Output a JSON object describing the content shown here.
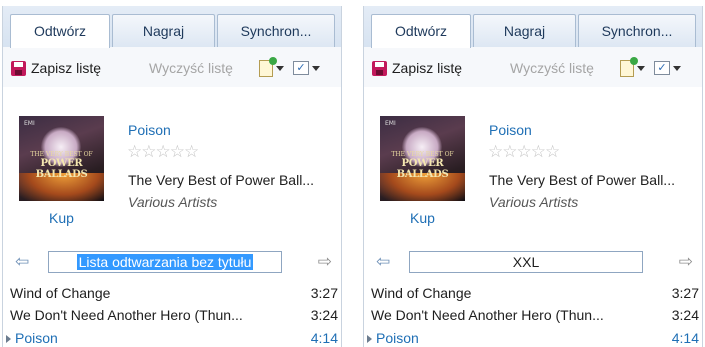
{
  "panels": [
    {
      "tabs": [
        "Odtwórz",
        "Nagraj",
        "Synchron..."
      ],
      "toolbar": {
        "save_label": "Zapisz listę",
        "clear_label": "Wyczyść listę"
      },
      "now_playing": {
        "title": "Poison",
        "album": "The Very Best of Power Ball...",
        "artist": "Various Artists",
        "rating": 0,
        "buy_label": "Kup"
      },
      "playlist_name": "Lista odtwarzania bez tytułu",
      "tracks": [
        {
          "title": "Wind of Change",
          "duration": "3:27"
        },
        {
          "title": "We Don't Need Another Hero (Thun...",
          "duration": "3:24"
        },
        {
          "title": "Poison",
          "duration": "4:14"
        }
      ]
    },
    {
      "tabs": [
        "Odtwórz",
        "Nagraj",
        "Synchron..."
      ],
      "toolbar": {
        "save_label": "Zapisz listę",
        "clear_label": "Wyczyść listę"
      },
      "now_playing": {
        "title": "Poison",
        "album": "The Very Best of Power Ball...",
        "artist": "Various Artists",
        "rating": 0,
        "buy_label": "Kup"
      },
      "playlist_name": "XXL",
      "tracks": [
        {
          "title": "Wind of Change",
          "duration": "3:27"
        },
        {
          "title": "We Don't Need Another Hero (Thun...",
          "duration": "3:24"
        },
        {
          "title": "Poison",
          "duration": "4:14"
        }
      ]
    }
  ],
  "album_art_text": [
    "THE VERY BEST OF",
    "POWER BALLADS"
  ],
  "colors": {
    "link": "#1f6fb5",
    "selection": "#3399ff",
    "save_icon": "#c2185b"
  }
}
